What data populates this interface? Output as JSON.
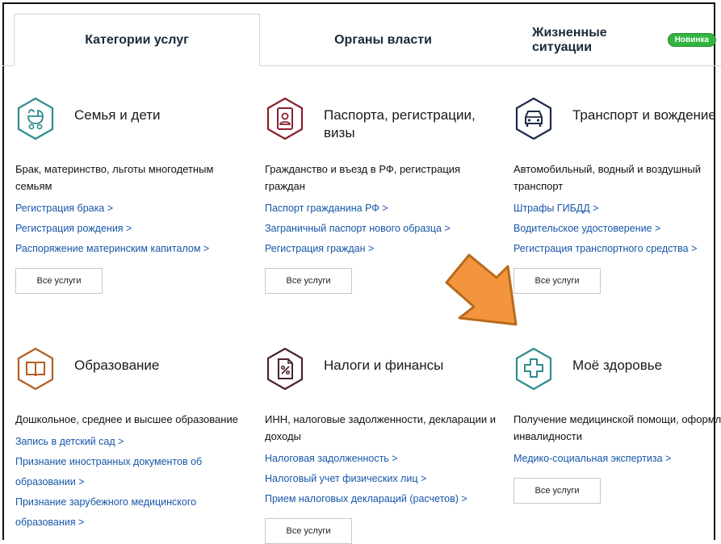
{
  "tabs": [
    {
      "label": "Категории услуг"
    },
    {
      "label": "Органы власти"
    },
    {
      "label": "Жизненные ситуации",
      "badge": "Новинка"
    }
  ],
  "colors": {
    "link": "#1756a8",
    "badge_green": "#32b53f",
    "arrow_orange": "#f2953e",
    "family_icon": "#2f8c8c",
    "passport_icon": "#8a1f2a",
    "transport_icon": "#1d2b4a",
    "education_icon": "#b45e22",
    "taxes_icon": "#4a2236",
    "health_icon": "#2f8c8c"
  },
  "categories": [
    {
      "icon": "stroller-icon",
      "title": "Семья и дети",
      "desc": "Брак, материнство, льготы многодетным семьям",
      "links": [
        "Регистрация брака >",
        "Регистрация рождения >",
        "Распоряжение материнским капиталом >"
      ],
      "button": "Все услуги"
    },
    {
      "icon": "passport-icon",
      "title": "Паспорта, регистрации, визы",
      "desc": "Гражданство и въезд в РФ, регистрация граждан",
      "links": [
        "Паспорт гражданина РФ >",
        "Заграничный паспорт нового образца >",
        "Регистрация граждан >"
      ],
      "button": "Все услуги"
    },
    {
      "icon": "car-icon",
      "title": "Транспорт и вождение",
      "desc": "Автомобильный, водный и воздушный транспорт",
      "links": [
        "Штрафы ГИБДД >",
        "Водительское удостоверение >",
        "Регистрация транспортного средства >"
      ],
      "button": "Все услуги"
    },
    {
      "icon": "book-icon",
      "title": "Образование",
      "desc": "Дошкольное, среднее и высшее образование",
      "links": [
        "Запись в детский сад >",
        "Признание иностранных документов об",
        "образовании >",
        "Признание зарубежного медицинского",
        "образования >"
      ],
      "button": ""
    },
    {
      "icon": "tax-document-icon",
      "title": "Налоги и финансы",
      "desc": "ИНН, налоговые задолженности, декларации и доходы",
      "links": [
        "Налоговая задолженность >",
        "Налоговый учет физических лиц >",
        "Прием налоговых деклараций (расчетов) >"
      ],
      "button": "Все услуги"
    },
    {
      "icon": "medical-cross-icon",
      "title": "Моё здоровье",
      "desc": "Получение медицинской помощи, оформление инвалидности",
      "links": [
        "Медико-социальная экспертиза >"
      ],
      "button": "Все услуги"
    }
  ]
}
